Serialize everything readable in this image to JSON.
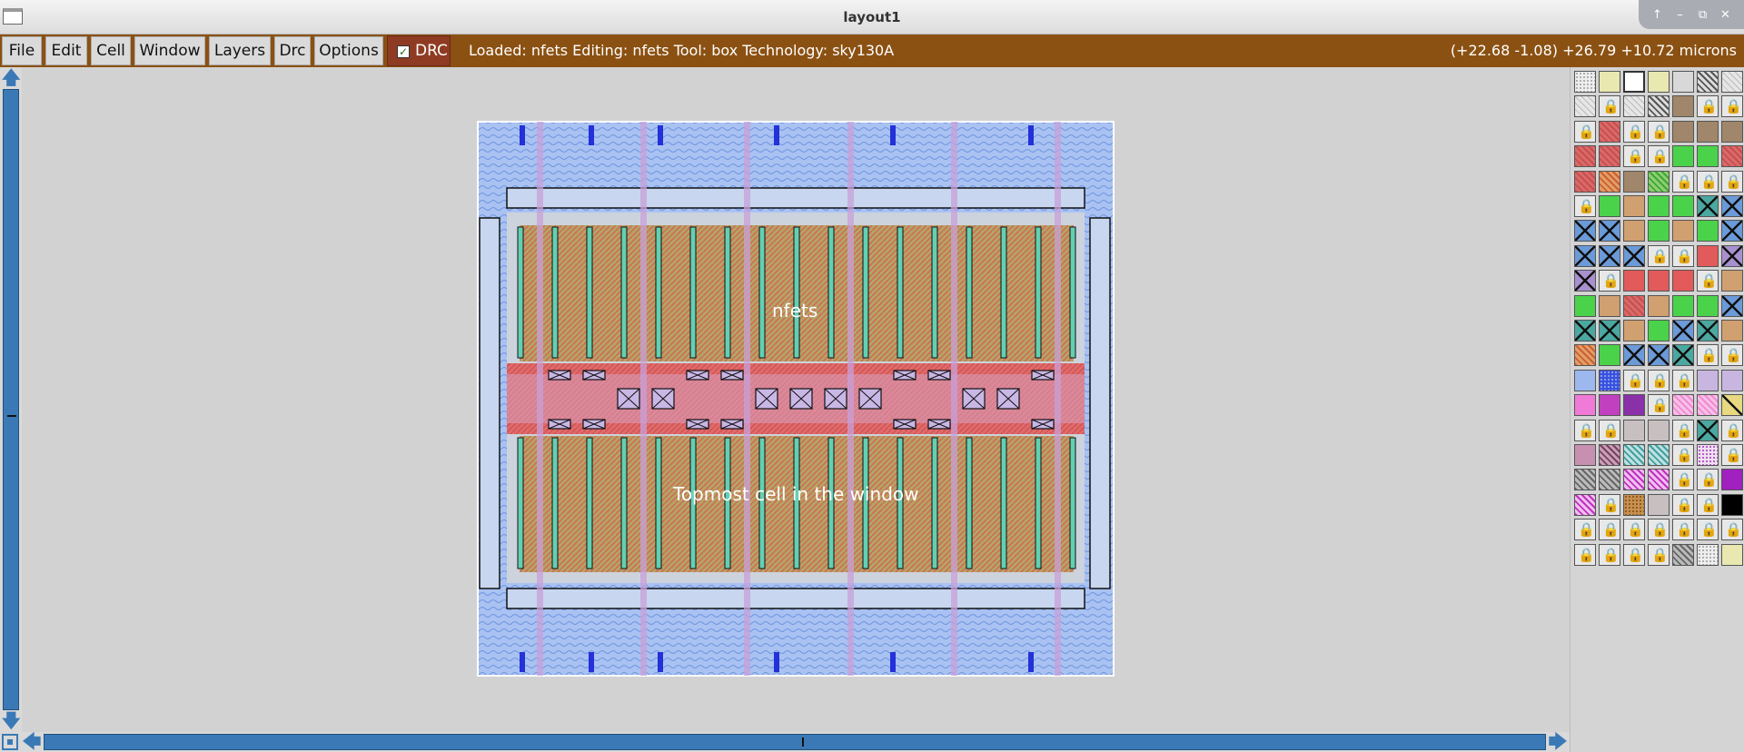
{
  "window": {
    "title": "layout1",
    "controls": [
      "↑",
      "–",
      "⧉",
      "✕"
    ]
  },
  "menu": {
    "items": [
      "File",
      "Edit",
      "Cell",
      "Window",
      "Layers",
      "Drc",
      "Options"
    ],
    "drc_toggle": {
      "label": "DRC",
      "checked": true
    }
  },
  "status": {
    "text": "Loaded: nfets Editing: nfets Tool: box  Technology: sky130A",
    "coords": "(+22.68 -1.08) +26.79 +10.72 microns"
  },
  "canvas": {
    "cell_name": "nfets",
    "cell_hint": "Topmost cell in the window"
  },
  "colors": {
    "menubar": "#8b5112",
    "drc_button": "#8f3b23",
    "scrollbar": "#3a79b6",
    "metal1": "#9db8ef",
    "poly": "#e46565",
    "diffusion": "#c9a476",
    "ndiff_green": "#5fc35f",
    "local_interconnect": "#c8a0d8"
  },
  "palette": {
    "rows": [
      [
        "dots-white",
        "yellow-box",
        "outline",
        "yellow-box",
        "blank",
        "hatch-dark",
        "hatch-light"
      ],
      [
        "hatch-light",
        "lock",
        "hatch-light",
        "hatch-dark",
        "brown",
        "lock",
        "lock"
      ],
      [
        "lock",
        "red-hatch",
        "lock",
        "lock",
        "brown",
        "brown",
        "brown"
      ],
      [
        "red-hatch",
        "red-hatch",
        "lock",
        "lock",
        "green",
        "green",
        "red-hatch"
      ],
      [
        "red-hatch",
        "orange-hatch",
        "brown",
        "green-hatch",
        "lock",
        "lock",
        "lock"
      ],
      [
        "lock",
        "green",
        "tan",
        "green",
        "green",
        "teal-x",
        "blue-x"
      ],
      [
        "blue-x",
        "blue-x",
        "tan",
        "green",
        "tan",
        "green",
        "blue-x"
      ],
      [
        "blue-x",
        "blue-x",
        "blue-x",
        "lock",
        "lock",
        "red",
        "purple-x"
      ],
      [
        "purple-x",
        "lock",
        "red",
        "red",
        "red",
        "lock",
        "tan"
      ],
      [
        "green",
        "tan",
        "red-hatch",
        "tan",
        "green",
        "green",
        "blue-x"
      ],
      [
        "teal-x",
        "teal-x",
        "tan",
        "green",
        "blue-x",
        "teal-x",
        "tan"
      ],
      [
        "orange-hatch",
        "green",
        "blue-x",
        "blue-x",
        "teal-x",
        "lock",
        "lock"
      ],
      [
        "blue",
        "blue-dots",
        "lock",
        "lock",
        "lock",
        "lavender",
        "lavender"
      ],
      [
        "pink",
        "magenta",
        "purple",
        "lock",
        "pink-hatch",
        "pink-hatch",
        "yellow-x"
      ],
      [
        "lock",
        "lock",
        "grey",
        "grey",
        "lock",
        "teal-x",
        "lock"
      ],
      [
        "mauve",
        "mauve-hatch",
        "teal-hatch",
        "teal-hatch",
        "lock",
        "purple-dots",
        "lock"
      ],
      [
        "grey-hatch",
        "grey-hatch",
        "magenta-hatch",
        "magenta-hatch",
        "lock",
        "lock",
        "purple-solid"
      ],
      [
        "magenta-hatch",
        "lock",
        "orange-dots",
        "grey",
        "lock",
        "lock",
        "black"
      ],
      [
        "lock",
        "lock",
        "lock",
        "lock",
        "lock",
        "lock",
        "lock"
      ],
      [
        "lock",
        "lock",
        "lock",
        "lock",
        "grey-hatch",
        "dots-white",
        "yellow-box"
      ]
    ]
  }
}
